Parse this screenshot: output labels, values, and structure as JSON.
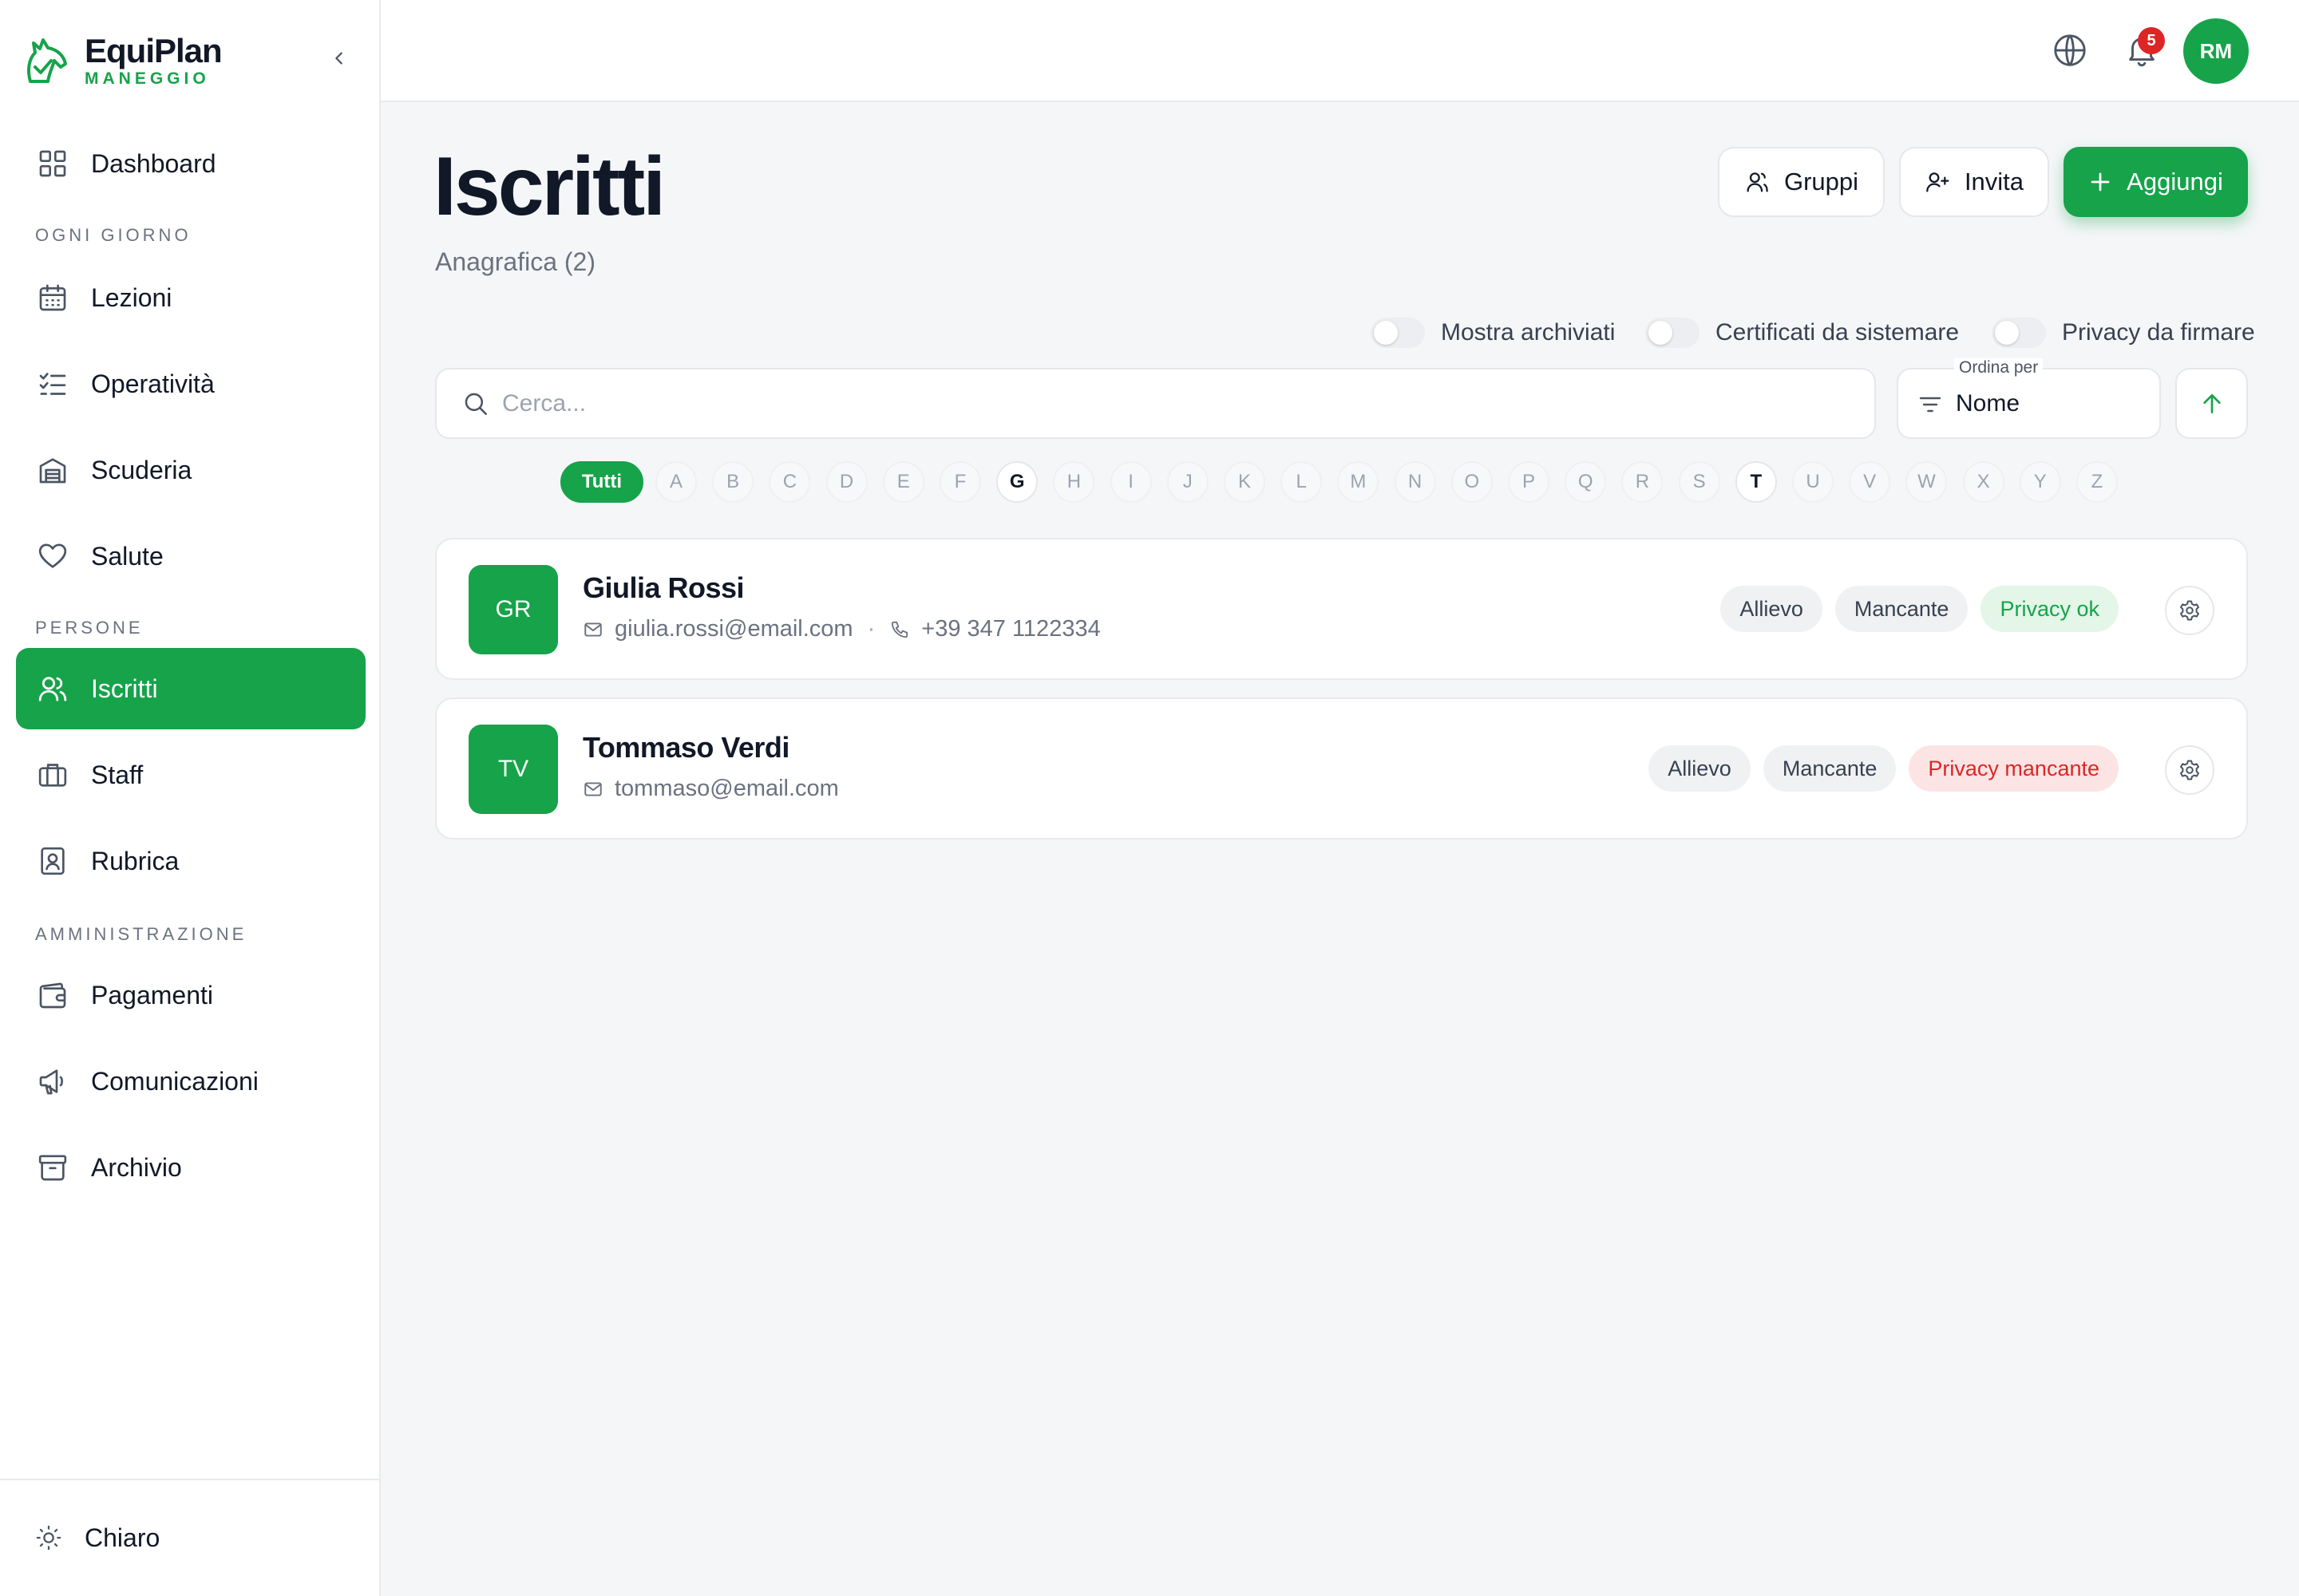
{
  "brand": {
    "name": "EquiPlan",
    "subtitle": "MANEGGIO"
  },
  "sidebar": {
    "sections": {
      "daily": "OGNI GIORNO",
      "people": "PERSONE",
      "admin": "AMMINISTRAZIONE"
    },
    "items": [
      {
        "label": "Dashboard",
        "icon": "grid-icon"
      },
      {
        "label": "Lezioni",
        "icon": "calendar-icon"
      },
      {
        "label": "Operatività",
        "icon": "checklist-icon"
      },
      {
        "label": "Scuderia",
        "icon": "stable-icon"
      },
      {
        "label": "Salute",
        "icon": "heart-icon"
      },
      {
        "label": "Iscritti",
        "icon": "users-icon",
        "active": true
      },
      {
        "label": "Staff",
        "icon": "briefcase-icon"
      },
      {
        "label": "Rubrica",
        "icon": "contact-book-icon"
      },
      {
        "label": "Pagamenti",
        "icon": "wallet-icon"
      },
      {
        "label": "Comunicazioni",
        "icon": "megaphone-icon"
      },
      {
        "label": "Archivio",
        "icon": "archive-icon"
      }
    ],
    "theme_label": "Chiaro"
  },
  "topbar": {
    "notifications_count": "5",
    "user_initials": "RM"
  },
  "header": {
    "title": "Iscritti",
    "subtitle": "Anagrafica (2)",
    "buttons": {
      "groups": "Gruppi",
      "invite": "Invita",
      "add": "Aggiungi"
    }
  },
  "filters": {
    "show_archived": "Mostra archiviati",
    "certificates": "Certificati da sistemare",
    "privacy": "Privacy da firmare"
  },
  "search": {
    "placeholder": "Cerca..."
  },
  "sort": {
    "caption": "Ordina per",
    "value": "Nome"
  },
  "alphabet": {
    "all_label": "Tutti",
    "letters": [
      "A",
      "B",
      "C",
      "D",
      "E",
      "F",
      "G",
      "H",
      "I",
      "J",
      "K",
      "L",
      "M",
      "N",
      "O",
      "P",
      "Q",
      "R",
      "S",
      "T",
      "U",
      "V",
      "W",
      "X",
      "Y",
      "Z"
    ],
    "available": [
      "G",
      "T"
    ]
  },
  "members": [
    {
      "initials": "GR",
      "name": "Giulia Rossi",
      "email": "giulia.rossi@email.com",
      "phone": "+39 347 1122334",
      "tags": [
        {
          "label": "Allievo",
          "status": "neutral"
        },
        {
          "label": "Mancante",
          "status": "neutral"
        },
        {
          "label": "Privacy ok",
          "status": "ok"
        }
      ]
    },
    {
      "initials": "TV",
      "name": "Tommaso Verdi",
      "email": "tommaso@email.com",
      "phone": "",
      "tags": [
        {
          "label": "Allievo",
          "status": "neutral"
        },
        {
          "label": "Mancante",
          "status": "neutral"
        },
        {
          "label": "Privacy mancante",
          "status": "bad"
        }
      ]
    }
  ],
  "colors": {
    "accent": "#16a34a",
    "danger": "#dc2626",
    "background": "#f5f6f8"
  }
}
